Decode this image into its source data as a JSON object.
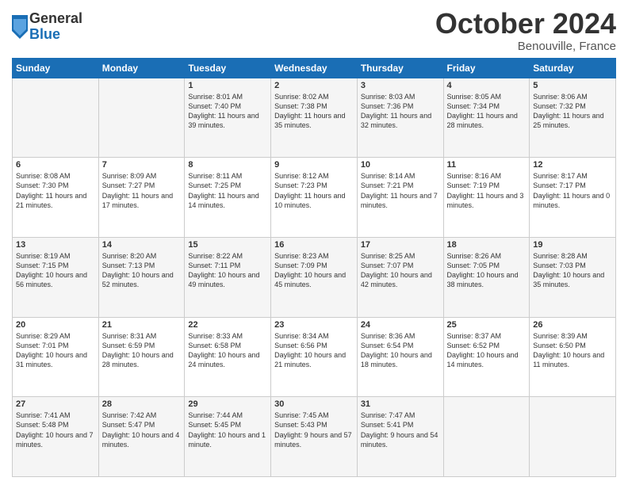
{
  "header": {
    "logo_general": "General",
    "logo_blue": "Blue",
    "month_title": "October 2024",
    "location": "Benouville, France"
  },
  "days_of_week": [
    "Sunday",
    "Monday",
    "Tuesday",
    "Wednesday",
    "Thursday",
    "Friday",
    "Saturday"
  ],
  "weeks": [
    [
      {
        "day": "",
        "info": ""
      },
      {
        "day": "",
        "info": ""
      },
      {
        "day": "1",
        "info": "Sunrise: 8:01 AM\nSunset: 7:40 PM\nDaylight: 11 hours and 39 minutes."
      },
      {
        "day": "2",
        "info": "Sunrise: 8:02 AM\nSunset: 7:38 PM\nDaylight: 11 hours and 35 minutes."
      },
      {
        "day": "3",
        "info": "Sunrise: 8:03 AM\nSunset: 7:36 PM\nDaylight: 11 hours and 32 minutes."
      },
      {
        "day": "4",
        "info": "Sunrise: 8:05 AM\nSunset: 7:34 PM\nDaylight: 11 hours and 28 minutes."
      },
      {
        "day": "5",
        "info": "Sunrise: 8:06 AM\nSunset: 7:32 PM\nDaylight: 11 hours and 25 minutes."
      }
    ],
    [
      {
        "day": "6",
        "info": "Sunrise: 8:08 AM\nSunset: 7:30 PM\nDaylight: 11 hours and 21 minutes."
      },
      {
        "day": "7",
        "info": "Sunrise: 8:09 AM\nSunset: 7:27 PM\nDaylight: 11 hours and 17 minutes."
      },
      {
        "day": "8",
        "info": "Sunrise: 8:11 AM\nSunset: 7:25 PM\nDaylight: 11 hours and 14 minutes."
      },
      {
        "day": "9",
        "info": "Sunrise: 8:12 AM\nSunset: 7:23 PM\nDaylight: 11 hours and 10 minutes."
      },
      {
        "day": "10",
        "info": "Sunrise: 8:14 AM\nSunset: 7:21 PM\nDaylight: 11 hours and 7 minutes."
      },
      {
        "day": "11",
        "info": "Sunrise: 8:16 AM\nSunset: 7:19 PM\nDaylight: 11 hours and 3 minutes."
      },
      {
        "day": "12",
        "info": "Sunrise: 8:17 AM\nSunset: 7:17 PM\nDaylight: 11 hours and 0 minutes."
      }
    ],
    [
      {
        "day": "13",
        "info": "Sunrise: 8:19 AM\nSunset: 7:15 PM\nDaylight: 10 hours and 56 minutes."
      },
      {
        "day": "14",
        "info": "Sunrise: 8:20 AM\nSunset: 7:13 PM\nDaylight: 10 hours and 52 minutes."
      },
      {
        "day": "15",
        "info": "Sunrise: 8:22 AM\nSunset: 7:11 PM\nDaylight: 10 hours and 49 minutes."
      },
      {
        "day": "16",
        "info": "Sunrise: 8:23 AM\nSunset: 7:09 PM\nDaylight: 10 hours and 45 minutes."
      },
      {
        "day": "17",
        "info": "Sunrise: 8:25 AM\nSunset: 7:07 PM\nDaylight: 10 hours and 42 minutes."
      },
      {
        "day": "18",
        "info": "Sunrise: 8:26 AM\nSunset: 7:05 PM\nDaylight: 10 hours and 38 minutes."
      },
      {
        "day": "19",
        "info": "Sunrise: 8:28 AM\nSunset: 7:03 PM\nDaylight: 10 hours and 35 minutes."
      }
    ],
    [
      {
        "day": "20",
        "info": "Sunrise: 8:29 AM\nSunset: 7:01 PM\nDaylight: 10 hours and 31 minutes."
      },
      {
        "day": "21",
        "info": "Sunrise: 8:31 AM\nSunset: 6:59 PM\nDaylight: 10 hours and 28 minutes."
      },
      {
        "day": "22",
        "info": "Sunrise: 8:33 AM\nSunset: 6:58 PM\nDaylight: 10 hours and 24 minutes."
      },
      {
        "day": "23",
        "info": "Sunrise: 8:34 AM\nSunset: 6:56 PM\nDaylight: 10 hours and 21 minutes."
      },
      {
        "day": "24",
        "info": "Sunrise: 8:36 AM\nSunset: 6:54 PM\nDaylight: 10 hours and 18 minutes."
      },
      {
        "day": "25",
        "info": "Sunrise: 8:37 AM\nSunset: 6:52 PM\nDaylight: 10 hours and 14 minutes."
      },
      {
        "day": "26",
        "info": "Sunrise: 8:39 AM\nSunset: 6:50 PM\nDaylight: 10 hours and 11 minutes."
      }
    ],
    [
      {
        "day": "27",
        "info": "Sunrise: 7:41 AM\nSunset: 5:48 PM\nDaylight: 10 hours and 7 minutes."
      },
      {
        "day": "28",
        "info": "Sunrise: 7:42 AM\nSunset: 5:47 PM\nDaylight: 10 hours and 4 minutes."
      },
      {
        "day": "29",
        "info": "Sunrise: 7:44 AM\nSunset: 5:45 PM\nDaylight: 10 hours and 1 minute."
      },
      {
        "day": "30",
        "info": "Sunrise: 7:45 AM\nSunset: 5:43 PM\nDaylight: 9 hours and 57 minutes."
      },
      {
        "day": "31",
        "info": "Sunrise: 7:47 AM\nSunset: 5:41 PM\nDaylight: 9 hours and 54 minutes."
      },
      {
        "day": "",
        "info": ""
      },
      {
        "day": "",
        "info": ""
      }
    ]
  ]
}
